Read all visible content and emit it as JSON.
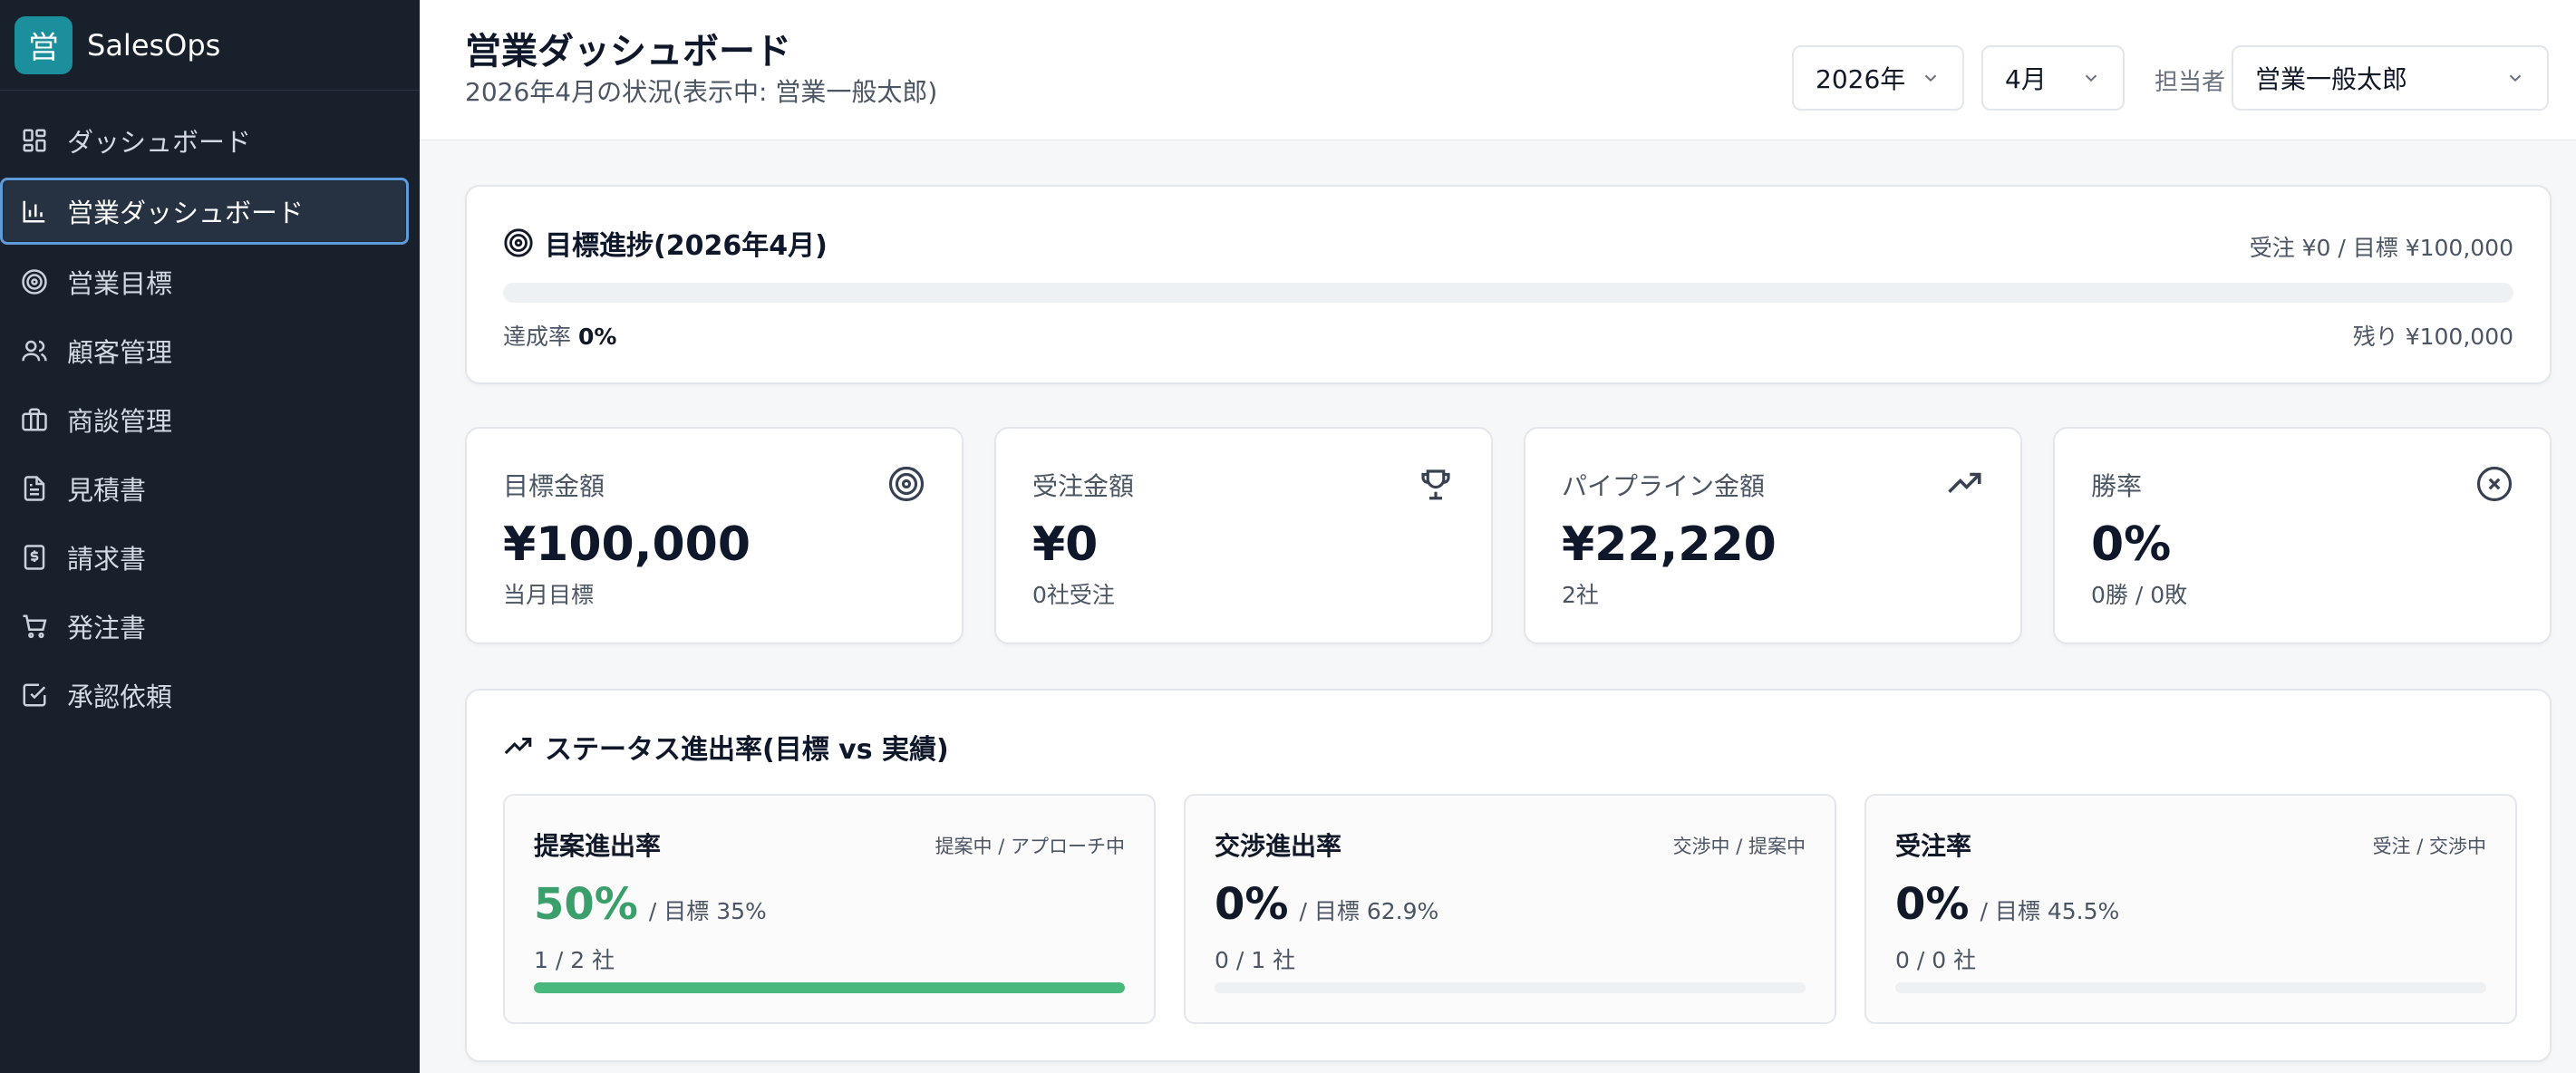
{
  "brand": {
    "logo_char": "営",
    "name": "SalesOps"
  },
  "sidebar": {
    "items": [
      {
        "label": "ダッシュボード",
        "icon": "dashboard-grid-icon"
      },
      {
        "label": "営業ダッシュボード",
        "icon": "bar-chart-icon",
        "active": true
      },
      {
        "label": "営業目標",
        "icon": "target-icon"
      },
      {
        "label": "顧客管理",
        "icon": "users-icon"
      },
      {
        "label": "商談管理",
        "icon": "briefcase-icon"
      },
      {
        "label": "見積書",
        "icon": "document-icon"
      },
      {
        "label": "請求書",
        "icon": "invoice-icon"
      },
      {
        "label": "発注書",
        "icon": "cart-icon"
      },
      {
        "label": "承認依頼",
        "icon": "check-square-icon"
      }
    ]
  },
  "header": {
    "title": "営業ダッシュボード",
    "subtitle": "2026年4月の状況(表示中: 営業一般太郎)",
    "year_value": "2026年",
    "month_value": "4月",
    "owner_label": "担当者",
    "owner_value": "営業一般太郎"
  },
  "goal": {
    "title": "目標進捗(2026年4月)",
    "summary": "受注 ¥0 / 目標 ¥100,000",
    "rate_label": "達成率",
    "rate_value": "0%",
    "progress": 0,
    "remaining": "残り ¥100,000"
  },
  "kpis": [
    {
      "label": "目標金額",
      "value": "¥100,000",
      "sub": "当月目標",
      "icon": "target-icon"
    },
    {
      "label": "受注金額",
      "value": "¥0",
      "sub": "0社受注",
      "icon": "trophy-icon"
    },
    {
      "label": "パイプライン金額",
      "value": "¥22,220",
      "sub": "2社",
      "icon": "trending-up-icon"
    },
    {
      "label": "勝率",
      "value": "0%",
      "sub": "0勝 / 0敗",
      "icon": "x-circle-icon"
    }
  ],
  "status": {
    "title": "ステータス進出率(目標 vs 実績)",
    "cards": [
      {
        "name": "提案進出率",
        "formula": "提案中 / アプローチ中",
        "value": "50%",
        "target": "/ 目標 35%",
        "count": "1 / 2 社",
        "progress": 1.0,
        "achieved": true
      },
      {
        "name": "交渉進出率",
        "formula": "交渉中 / 提案中",
        "value": "0%",
        "target": "/ 目標 62.9%",
        "count": "0 / 1 社",
        "progress": 0,
        "achieved": false
      },
      {
        "name": "受注率",
        "formula": "受注 / 交渉中",
        "value": "0%",
        "target": "/ 目標 45.5%",
        "count": "0 / 0 社",
        "progress": 0,
        "achieved": false
      }
    ]
  },
  "colors": {
    "sidebar_bg": "#18202c",
    "accent_green": "#3b9f6b",
    "brand_teal": "#1b8f9b"
  }
}
